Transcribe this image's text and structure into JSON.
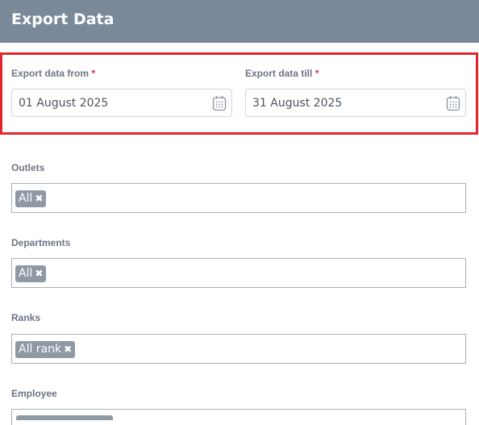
{
  "header": {
    "title": "Export Data"
  },
  "date_range": {
    "from": {
      "label": "Export data from",
      "required_mark": "*",
      "value": "01 August 2025",
      "icon": "calendar-icon"
    },
    "till": {
      "label": "Export data till",
      "required_mark": "*",
      "value": "31 August 2025",
      "icon": "calendar-icon"
    }
  },
  "filters": {
    "outlets": {
      "label": "Outlets",
      "tag": "All",
      "remove_glyph": "✖"
    },
    "departments": {
      "label": "Departments",
      "tag": "All",
      "remove_glyph": "✖"
    },
    "ranks": {
      "label": "Ranks",
      "tag": "All rank",
      "remove_glyph": "✖"
    },
    "employee": {
      "label": "Employee"
    }
  },
  "colors": {
    "header_bg": "#7a8999",
    "highlight": "#e3262e",
    "required": "#e0245e",
    "tag_bg": "#8e99a4"
  }
}
